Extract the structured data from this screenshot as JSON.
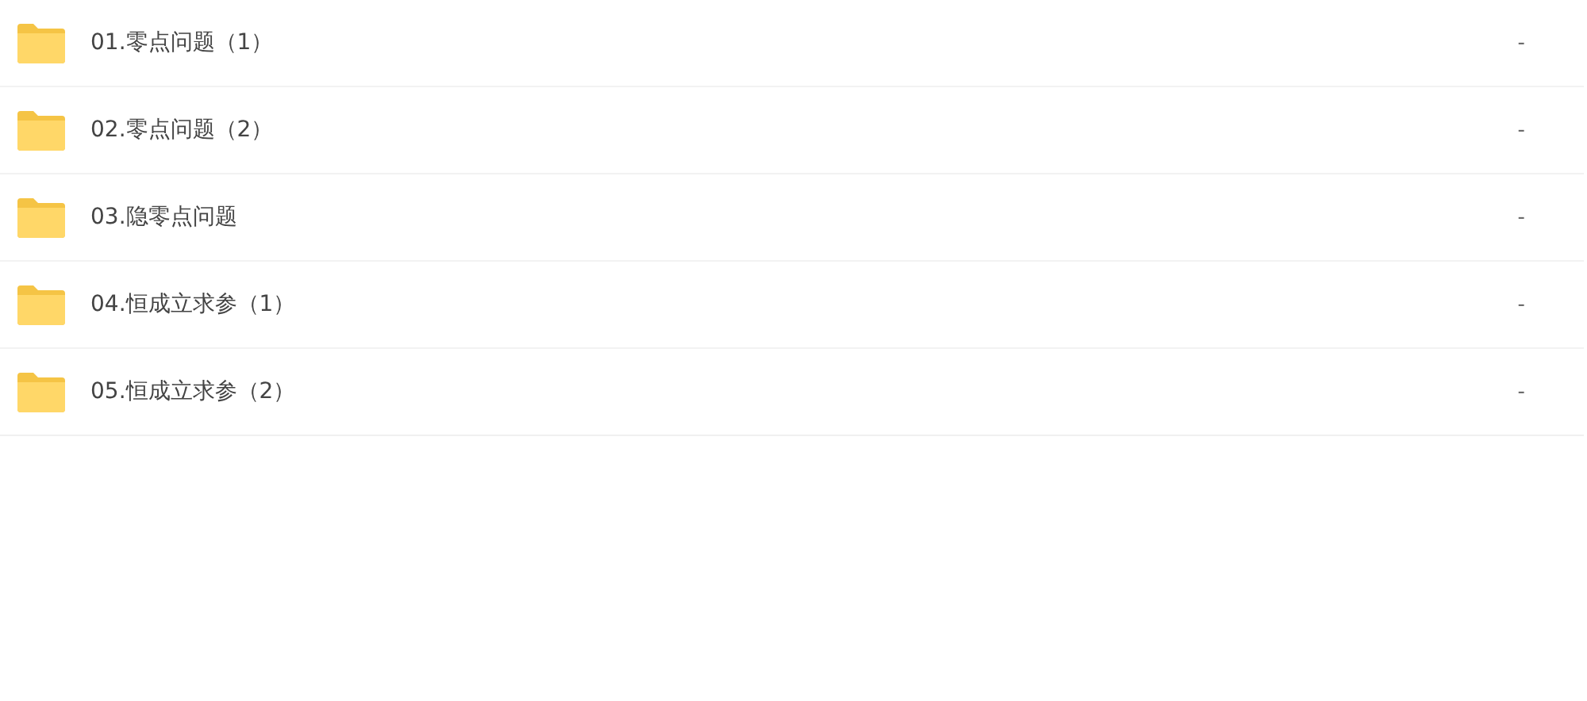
{
  "files": [
    {
      "name": "01.零点问题（1）",
      "size": "-"
    },
    {
      "name": "02.零点问题（2）",
      "size": "-"
    },
    {
      "name": "03.隐零点问题",
      "size": "-"
    },
    {
      "name": "04.恒成立求参（1）",
      "size": "-"
    },
    {
      "name": "05.恒成立求参（2）",
      "size": "-"
    }
  ]
}
